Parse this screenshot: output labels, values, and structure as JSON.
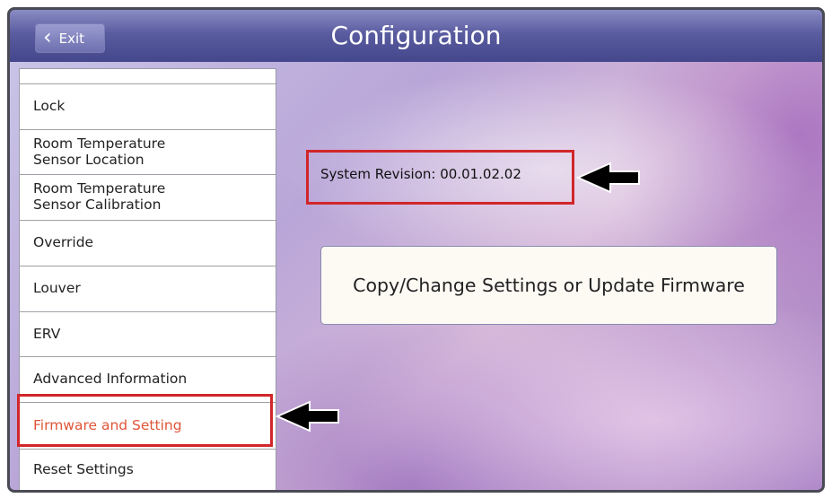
{
  "header": {
    "exit_label": "Exit",
    "title": "Configuration"
  },
  "sidebar": {
    "items": [
      {
        "label": ""
      },
      {
        "label": "Lock"
      },
      {
        "line1": "Room Temperature",
        "line2": "Sensor Location"
      },
      {
        "line1": "Room Temperature",
        "line2": "Sensor Calibration"
      },
      {
        "label": "Override"
      },
      {
        "label": "Louver"
      },
      {
        "label": "ERV"
      },
      {
        "label": "Advanced Information"
      },
      {
        "label": "Firmware and Setting"
      },
      {
        "label": "Reset Settings"
      }
    ],
    "selected_index": 8
  },
  "main": {
    "system_revision": "System Revision: 00.01.02.02",
    "action_button_label": "Copy/Change Settings or Update Firmware"
  },
  "colors": {
    "highlight_box": "#d1262a",
    "selected_text": "#e0553a",
    "titlebar": "#5a5ca0"
  }
}
